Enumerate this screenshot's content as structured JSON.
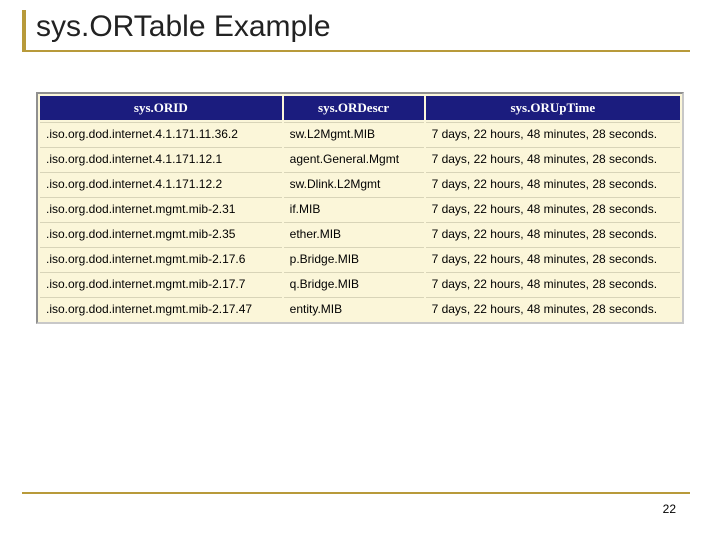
{
  "title": "sys.ORTable Example",
  "page_number": "22",
  "table": {
    "headers": [
      "sys.ORID",
      "sys.ORDescr",
      "sys.ORUpTime"
    ],
    "rows": [
      {
        "id": ".iso.org.dod.internet.4.1.171.11.36.2",
        "descr": "sw.L2Mgmt.MIB",
        "uptime": "7 days, 22 hours, 48 minutes, 28 seconds."
      },
      {
        "id": ".iso.org.dod.internet.4.1.171.12.1",
        "descr": "agent.General.Mgmt",
        "uptime": "7 days, 22 hours, 48 minutes, 28 seconds."
      },
      {
        "id": ".iso.org.dod.internet.4.1.171.12.2",
        "descr": "sw.Dlink.L2Mgmt",
        "uptime": "7 days, 22 hours, 48 minutes, 28 seconds."
      },
      {
        "id": ".iso.org.dod.internet.mgmt.mib-2.31",
        "descr": "if.MIB",
        "uptime": "7 days, 22 hours, 48 minutes, 28 seconds."
      },
      {
        "id": ".iso.org.dod.internet.mgmt.mib-2.35",
        "descr": "ether.MIB",
        "uptime": "7 days, 22 hours, 48 minutes, 28 seconds."
      },
      {
        "id": ".iso.org.dod.internet.mgmt.mib-2.17.6",
        "descr": "p.Bridge.MIB",
        "uptime": "7 days, 22 hours, 48 minutes, 28 seconds."
      },
      {
        "id": ".iso.org.dod.internet.mgmt.mib-2.17.7",
        "descr": "q.Bridge.MIB",
        "uptime": "7 days, 22 hours, 48 minutes, 28 seconds."
      },
      {
        "id": ".iso.org.dod.internet.mgmt.mib-2.17.47",
        "descr": "entity.MIB",
        "uptime": "7 days, 22 hours, 48 minutes, 28 seconds."
      }
    ]
  }
}
